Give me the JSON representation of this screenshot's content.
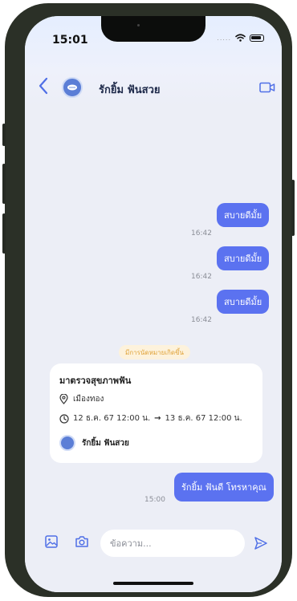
{
  "status_bar": {
    "time": "15:01",
    "signal_dots": "....."
  },
  "header": {
    "contact_name": "รักยิ้ม ฟันสวย"
  },
  "messages": [
    {
      "text": "สบายดีมั้ย",
      "time": "16:42"
    },
    {
      "text": "สบายดีมั้ย",
      "time": "16:42"
    },
    {
      "text": "สบายดีมั้ย",
      "time": "16:42"
    }
  ],
  "event_notice": "มีการนัดหมายเกิดขึ้น",
  "appointment": {
    "title": "มาตรวจสุขภาพฟัน",
    "location": "เมืองทอง",
    "start": "12 ธ.ค. 67 12:00 น.",
    "arrow": "→",
    "end": "13 ธ.ค. 67 12:00 น.",
    "user_name": "รักยิ้ม ฟันสวย"
  },
  "last_message": {
    "text": "รักยิ้ม ฟันดี โทรหาคุณ",
    "time": "15:00"
  },
  "composer": {
    "placeholder": "ข้อความ..."
  },
  "colors": {
    "accent": "#5b72f0",
    "notice_text": "#e0a33a",
    "notice_bg": "#fdf2dc",
    "background": "#eceef6"
  }
}
